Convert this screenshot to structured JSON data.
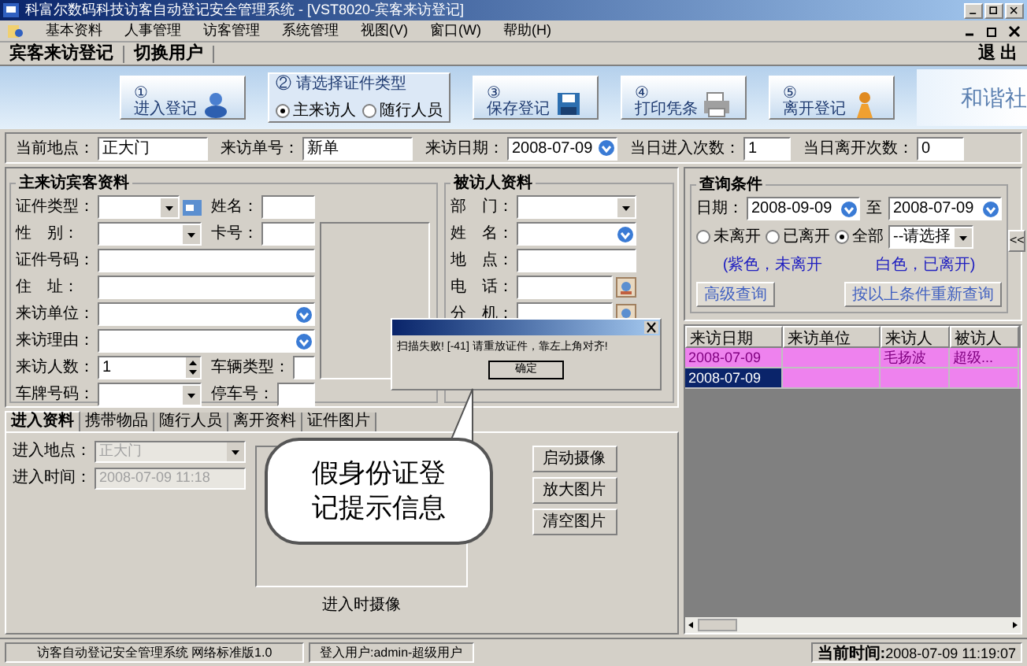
{
  "window": {
    "title": "科富尔数码科技访客自动登记安全管理系统 - [VST8020-宾客来访登记]"
  },
  "menu": [
    "基本资料",
    "人事管理",
    "访客管理",
    "系统管理",
    "视图(V)",
    "窗口(W)",
    "帮助(H)"
  ],
  "toolbar": {
    "items": [
      "宾客来访登记",
      "切换用户"
    ],
    "exit": "退 出"
  },
  "banner": {
    "buttons": [
      {
        "number": "①",
        "label": "进入登记",
        "kind": "enter"
      },
      {
        "number": "③",
        "label": "保存登记",
        "kind": "save"
      },
      {
        "number": "④",
        "label": "打印凭条",
        "kind": "print"
      },
      {
        "number": "⑤",
        "label": "离开登记",
        "kind": "leave"
      }
    ],
    "id_type": "② 请选择证件类型",
    "radios": [
      {
        "label": "主来访人",
        "selected": true
      },
      {
        "label": "随行人员",
        "selected": false
      }
    ],
    "slogan": "和谐社"
  },
  "info": [
    {
      "label": "当前地点：",
      "value": "正大门"
    },
    {
      "label": "来访单号：",
      "value": "新单"
    },
    {
      "label": "来访日期：",
      "value": "2008-07-09",
      "kind": "date"
    },
    {
      "label": "当日进入次数：",
      "value": "1"
    },
    {
      "label": "当日离开次数：",
      "value": "0"
    }
  ],
  "visitor": {
    "title": "主来访宾客资料",
    "rows": [
      [
        {
          "label": "证件类型：",
          "kind": "select",
          "card": true
        },
        {
          "label": "姓名：",
          "kind": "text"
        }
      ],
      [
        {
          "label": "性　别：",
          "kind": "select"
        },
        {
          "label": "卡号：",
          "kind": "text"
        }
      ],
      [
        {
          "label": "证件号码：",
          "kind": "text"
        }
      ],
      [
        {
          "label": "住　址：",
          "kind": "text"
        }
      ],
      [
        {
          "label": "来访单位：",
          "kind": "lookup"
        }
      ],
      [
        {
          "label": "来访理由：",
          "kind": "lookup"
        }
      ],
      [
        {
          "label": "来访人数：",
          "kind": "spin",
          "value": "1"
        },
        {
          "label": "车辆类型：",
          "kind": "text"
        }
      ],
      [
        {
          "label": "车牌号码：",
          "kind": "select"
        },
        {
          "label": "停车号：",
          "kind": "text"
        }
      ]
    ]
  },
  "host": {
    "title": "被访人资料",
    "fields": [
      {
        "label": "部　门：",
        "kind": "select"
      },
      {
        "label": "姓　名：",
        "kind": "lookup"
      },
      {
        "label": "地　点：",
        "kind": "text"
      },
      {
        "label": "电　话：",
        "kind": "phone"
      },
      {
        "label": "分　机：",
        "kind": "phone"
      }
    ]
  },
  "query": {
    "title": "查询条件",
    "date_label": "日期：",
    "from": "2008-09-09",
    "to_label": "至",
    "to": "2008-07-09",
    "radios": [
      {
        "label": "未离开",
        "selected": false
      },
      {
        "label": "已离开",
        "selected": false
      },
      {
        "label": "全部",
        "selected": true
      }
    ],
    "status_select": "--请选择",
    "legend": [
      "(紫色，未离开",
      "白色，已离开)"
    ],
    "buttons": [
      "高级查询",
      "按以上条件重新查询"
    ],
    "collapse": "<<"
  },
  "table": {
    "columns": [
      "来访日期",
      "来访单位",
      "来访人",
      "被访人"
    ],
    "rows": [
      {
        "cells": [
          "2008-07-09",
          "",
          "毛扬波",
          "超级..."
        ],
        "selected": false
      },
      {
        "cells": [
          "2008-07-09",
          "",
          "",
          ""
        ],
        "selected": true
      }
    ]
  },
  "tabs": [
    {
      "label": "进入资料",
      "selected": true
    },
    {
      "label": "携带物品",
      "selected": false
    },
    {
      "label": "随行人员",
      "selected": false
    },
    {
      "label": "离开资料",
      "selected": false
    },
    {
      "label": "证件图片",
      "selected": false
    }
  ],
  "entry": {
    "fields": [
      {
        "label": "进入地点：",
        "value": "正大门",
        "kind": "select",
        "disabled": true
      },
      {
        "label": "进入时间：",
        "value": "2008-07-09 11:18",
        "kind": "text",
        "disabled": true
      }
    ],
    "camera_caption": "进入时摄像",
    "buttons": [
      "启动摄像",
      "放大图片",
      "清空图片"
    ]
  },
  "dialog": {
    "message": "扫描失败! [-41] 请重放证件，靠左上角对齐!",
    "ok": "确定"
  },
  "callout": "假身份证登记提示信息",
  "status_bar": {
    "segments": [
      "访客自动登记安全管理系统 网络标准版1.0",
      "登入用户:admin-超级用户"
    ],
    "time_label": "当前时间:",
    "time": "2008-07-09 11:19:07"
  }
}
